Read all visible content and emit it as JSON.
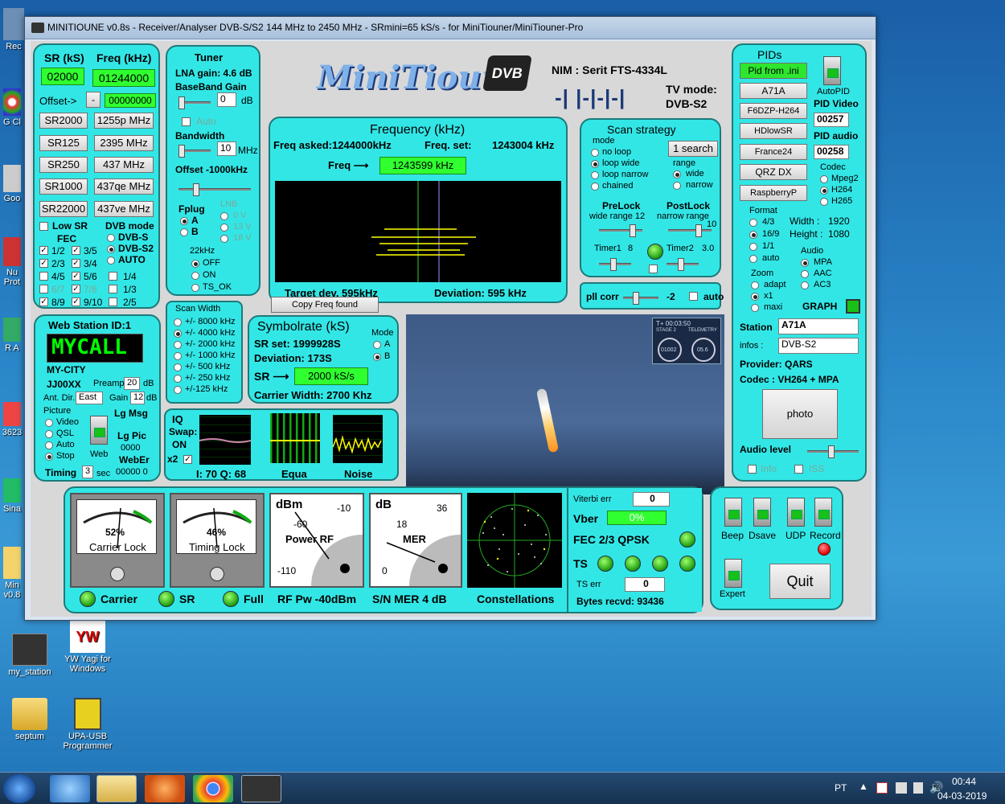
{
  "desktop": {
    "icons": [
      {
        "label": "my_station"
      },
      {
        "label": "YW Yagi for Windows"
      },
      {
        "label": "septum"
      },
      {
        "label": "UPA-USB Programmer"
      },
      {
        "label": "Rec"
      },
      {
        "label": "G Cl"
      },
      {
        "label": "Goo"
      },
      {
        "label": "Nu Prot"
      },
      {
        "label": "R A"
      },
      {
        "label": "3623"
      },
      {
        "label": "Sina"
      },
      {
        "label": "Min v0.8"
      }
    ]
  },
  "window": {
    "title": "MINITIOUNE v0.8s - Receiver/Analyser DVB-S/S2 144 MHz to 2450 MHz - SRmini=65 kS/s - for MiniTiouner/MiniTiouner-Pro"
  },
  "sr_panel": {
    "sr_label": "SR (kS)",
    "freq_label": "Freq (kHz)",
    "sr_value": "02000",
    "freq_value": "01244000",
    "offset_label": "Offset->",
    "offset_sign": "-",
    "offset_value": "00000000",
    "buttons": [
      "SR2000",
      "1255p MHz",
      "SR125",
      "2395 MHz",
      "SR250",
      "437 MHz",
      "SR1000",
      "437qe MHz",
      "SR22000",
      "437ve MHz"
    ],
    "low_sr": "Low SR",
    "dvb_mode": "DVB mode",
    "fec": "FEC",
    "dvb_opts": [
      "DVB-S",
      "DVB-S2",
      "AUTO"
    ],
    "fec_opts": [
      "1/2",
      "3/5",
      "2/3",
      "3/4",
      "4/5",
      "5/6",
      "6/7",
      "7/8",
      "8/9",
      "9/10"
    ],
    "extra": [
      "1/4",
      "1/3",
      "2/5"
    ]
  },
  "tuner": {
    "title": "Tuner",
    "lna": "LNA gain: 4.6 dB",
    "bb": "BaseBand Gain",
    "bb_value": "0",
    "bb_unit": "dB",
    "auto": "Auto",
    "bandwidth": "Bandwidth",
    "bw_value": "10",
    "bw_unit": "MHz",
    "offset": "Offset  -1000kHz",
    "fplug": "Fplug",
    "fplug_opts": [
      "A",
      "B"
    ],
    "lnb": "LNB",
    "lnb_opts": [
      "0 V",
      "13 V",
      "18 V"
    ],
    "khz": "22kHz",
    "khz_opts": [
      "OFF",
      "ON",
      "TS_OK"
    ]
  },
  "logo": {
    "text": "MiniTioune",
    "badge": "DVB"
  },
  "nim": {
    "label": "NIM :  Serit FTS-4334L",
    "tv_mode": "TV mode:",
    "tv_value": "DVB-S2",
    "lock_text": "-| |-|-|-|"
  },
  "frequency": {
    "title": "Frequency (kHz)",
    "asked": "Freq asked:1244000kHz",
    "set_label": "Freq. set:",
    "set_value": "1243004 kHz",
    "freq_label": "Freq",
    "freq_value": "1243599 kHz",
    "target": "Target dev. 595kHz",
    "deviation": "Deviation: 595 kHz"
  },
  "scan": {
    "title": "Scan strategy",
    "mode": "mode",
    "modes": [
      "no loop",
      "loop wide",
      "loop narrow",
      "chained"
    ],
    "search": "1 search",
    "range": "range",
    "ranges": [
      "wide",
      "narrow"
    ],
    "prelock": "PreLock",
    "prelock_sub": "wide range  12",
    "postlock": "PostLock",
    "postlock_sub": "narrow range",
    "postlock_val": "10",
    "timer1": "Timer1",
    "timer1_val": "8",
    "timer2": "Timer2",
    "timer2_val": "3.0"
  },
  "pll": {
    "label": "pll corr",
    "value": "-2",
    "auto": "auto"
  },
  "pids": {
    "title": "PIDs",
    "buttons": [
      "Pid from .ini",
      "A71A",
      "F6DZP-H264",
      "HDlowSR",
      "France24",
      "QRZ DX",
      "RaspberryP"
    ],
    "autopid": "AutoPID",
    "pid_video": "PID Video",
    "video_value": "00257",
    "pid_audio": "PID audio",
    "audio_value": "00258",
    "codec": "Codec",
    "codecs": [
      "Mpeg2",
      "H264",
      "H265"
    ],
    "format": "Format",
    "formats": [
      "4/3",
      "16/9",
      "1/1",
      "auto"
    ],
    "width": "Width :",
    "width_val": "1920",
    "height": "Height :",
    "height_val": "1080",
    "audio": "Audio",
    "audios": [
      "MPA",
      "AAC",
      "AC3"
    ],
    "zoom": "Zoom",
    "zooms": [
      "adapt",
      "x1",
      "maxi"
    ],
    "graph": "GRAPH",
    "station": "Station",
    "station_val": "A71A",
    "infos": "infos :",
    "infos_val": "DVB-S2",
    "provider": "Provider:    QARS",
    "codec_info": "Codec :  VH264 + MPA",
    "photo": "photo",
    "audio_level": "Audio level",
    "info": "Info",
    "iss": "ISS"
  },
  "webstation": {
    "title": "Web Station ID:1",
    "call": "MYCALL",
    "city": "MY-CITY",
    "locator": "JJ00XX",
    "preamp": "Preamp",
    "preamp_val": "20",
    "preamp_unit": "dB",
    "antdir": "Ant. Dir.",
    "antdir_val": "East",
    "gain": "Gain",
    "gain_val": "12",
    "gain_unit": "dB",
    "picture": "Picture",
    "pic_opts": [
      "Video",
      "QSL",
      "Auto",
      "Stop"
    ],
    "web": "Web",
    "lgmsg": "Lg Msg",
    "lgpic": "Lg Pic",
    "lgpic_val": "0000",
    "weber": "WebEr",
    "weber_val": "00000  0",
    "timing": "Timing",
    "timing_val": "3",
    "timing_unit": "sec"
  },
  "scanwidth": {
    "title": "Scan Width",
    "opts": [
      "+/- 8000 kHz",
      "+/- 4000 kHz",
      "+/- 2000 kHz",
      "+/- 1000 kHz",
      "+/- 500 kHz",
      "+/- 250 kHz",
      "+/-125 kHz"
    ]
  },
  "copyfreq": "Copy Freq found",
  "symbolrate": {
    "title": "Symbolrate (kS)",
    "set": "SR set:  1999928S",
    "deviation": "Deviation: 173S",
    "sr_label": "SR",
    "sr_value": "2000 kS/s",
    "carrier": "Carrier Width:    2700 Khz",
    "mode": "Mode",
    "modes": [
      "A",
      "B"
    ]
  },
  "iq": {
    "title": "IQ",
    "swap": "Swap:",
    "swap_val": "ON",
    "x2": "x2",
    "iq_vals": "I: 70 Q: 68",
    "equa": "Equa",
    "noise": "Noise"
  },
  "video": {
    "overlay_time": "T+ 00:03:50",
    "stage": "STAGE 2",
    "telemetry": "TELEMETRY",
    "speed": "01002",
    "alt": "05.6"
  },
  "meters": {
    "carrier_pct": "52%",
    "carrier": "Carrier Lock",
    "timing_pct": "46%",
    "timing": "Timing Lock",
    "power_unit": "dBm",
    "power_m10": "-10",
    "power_m60": "-60",
    "power_label": "Power RF",
    "power_m110": "-110",
    "mer_unit": "dB",
    "mer_36": "36",
    "mer_18": "18",
    "mer_label": "MER",
    "mer_0": "0",
    "constellations": "Constellations"
  },
  "status": {
    "carrier": "Carrier",
    "sr": "SR",
    "full": "Full",
    "rfpw": "RF Pw -40dBm",
    "snmer": "S/N MER   4 dB"
  },
  "viterbi": {
    "label": "Viterbi err",
    "value": "0",
    "vber": "Vber",
    "vber_val": "0%",
    "fec": "FEC 2/3 QPSK",
    "ts": "TS",
    "ts_err": "TS err",
    "ts_err_val": "0",
    "bytes": "Bytes recvd:  93436"
  },
  "controls": {
    "beep": "Beep",
    "dsave": "Dsave",
    "udp": "UDP",
    "record": "Record",
    "expert": "Expert",
    "quit": "Quit"
  },
  "taskbar": {
    "lang": "PT",
    "time": "00:44",
    "date": "04-03-2019"
  },
  "colors": {
    "panel": "#33e6e6",
    "green_field": "#30ff30",
    "lcd": "#00ff00"
  }
}
